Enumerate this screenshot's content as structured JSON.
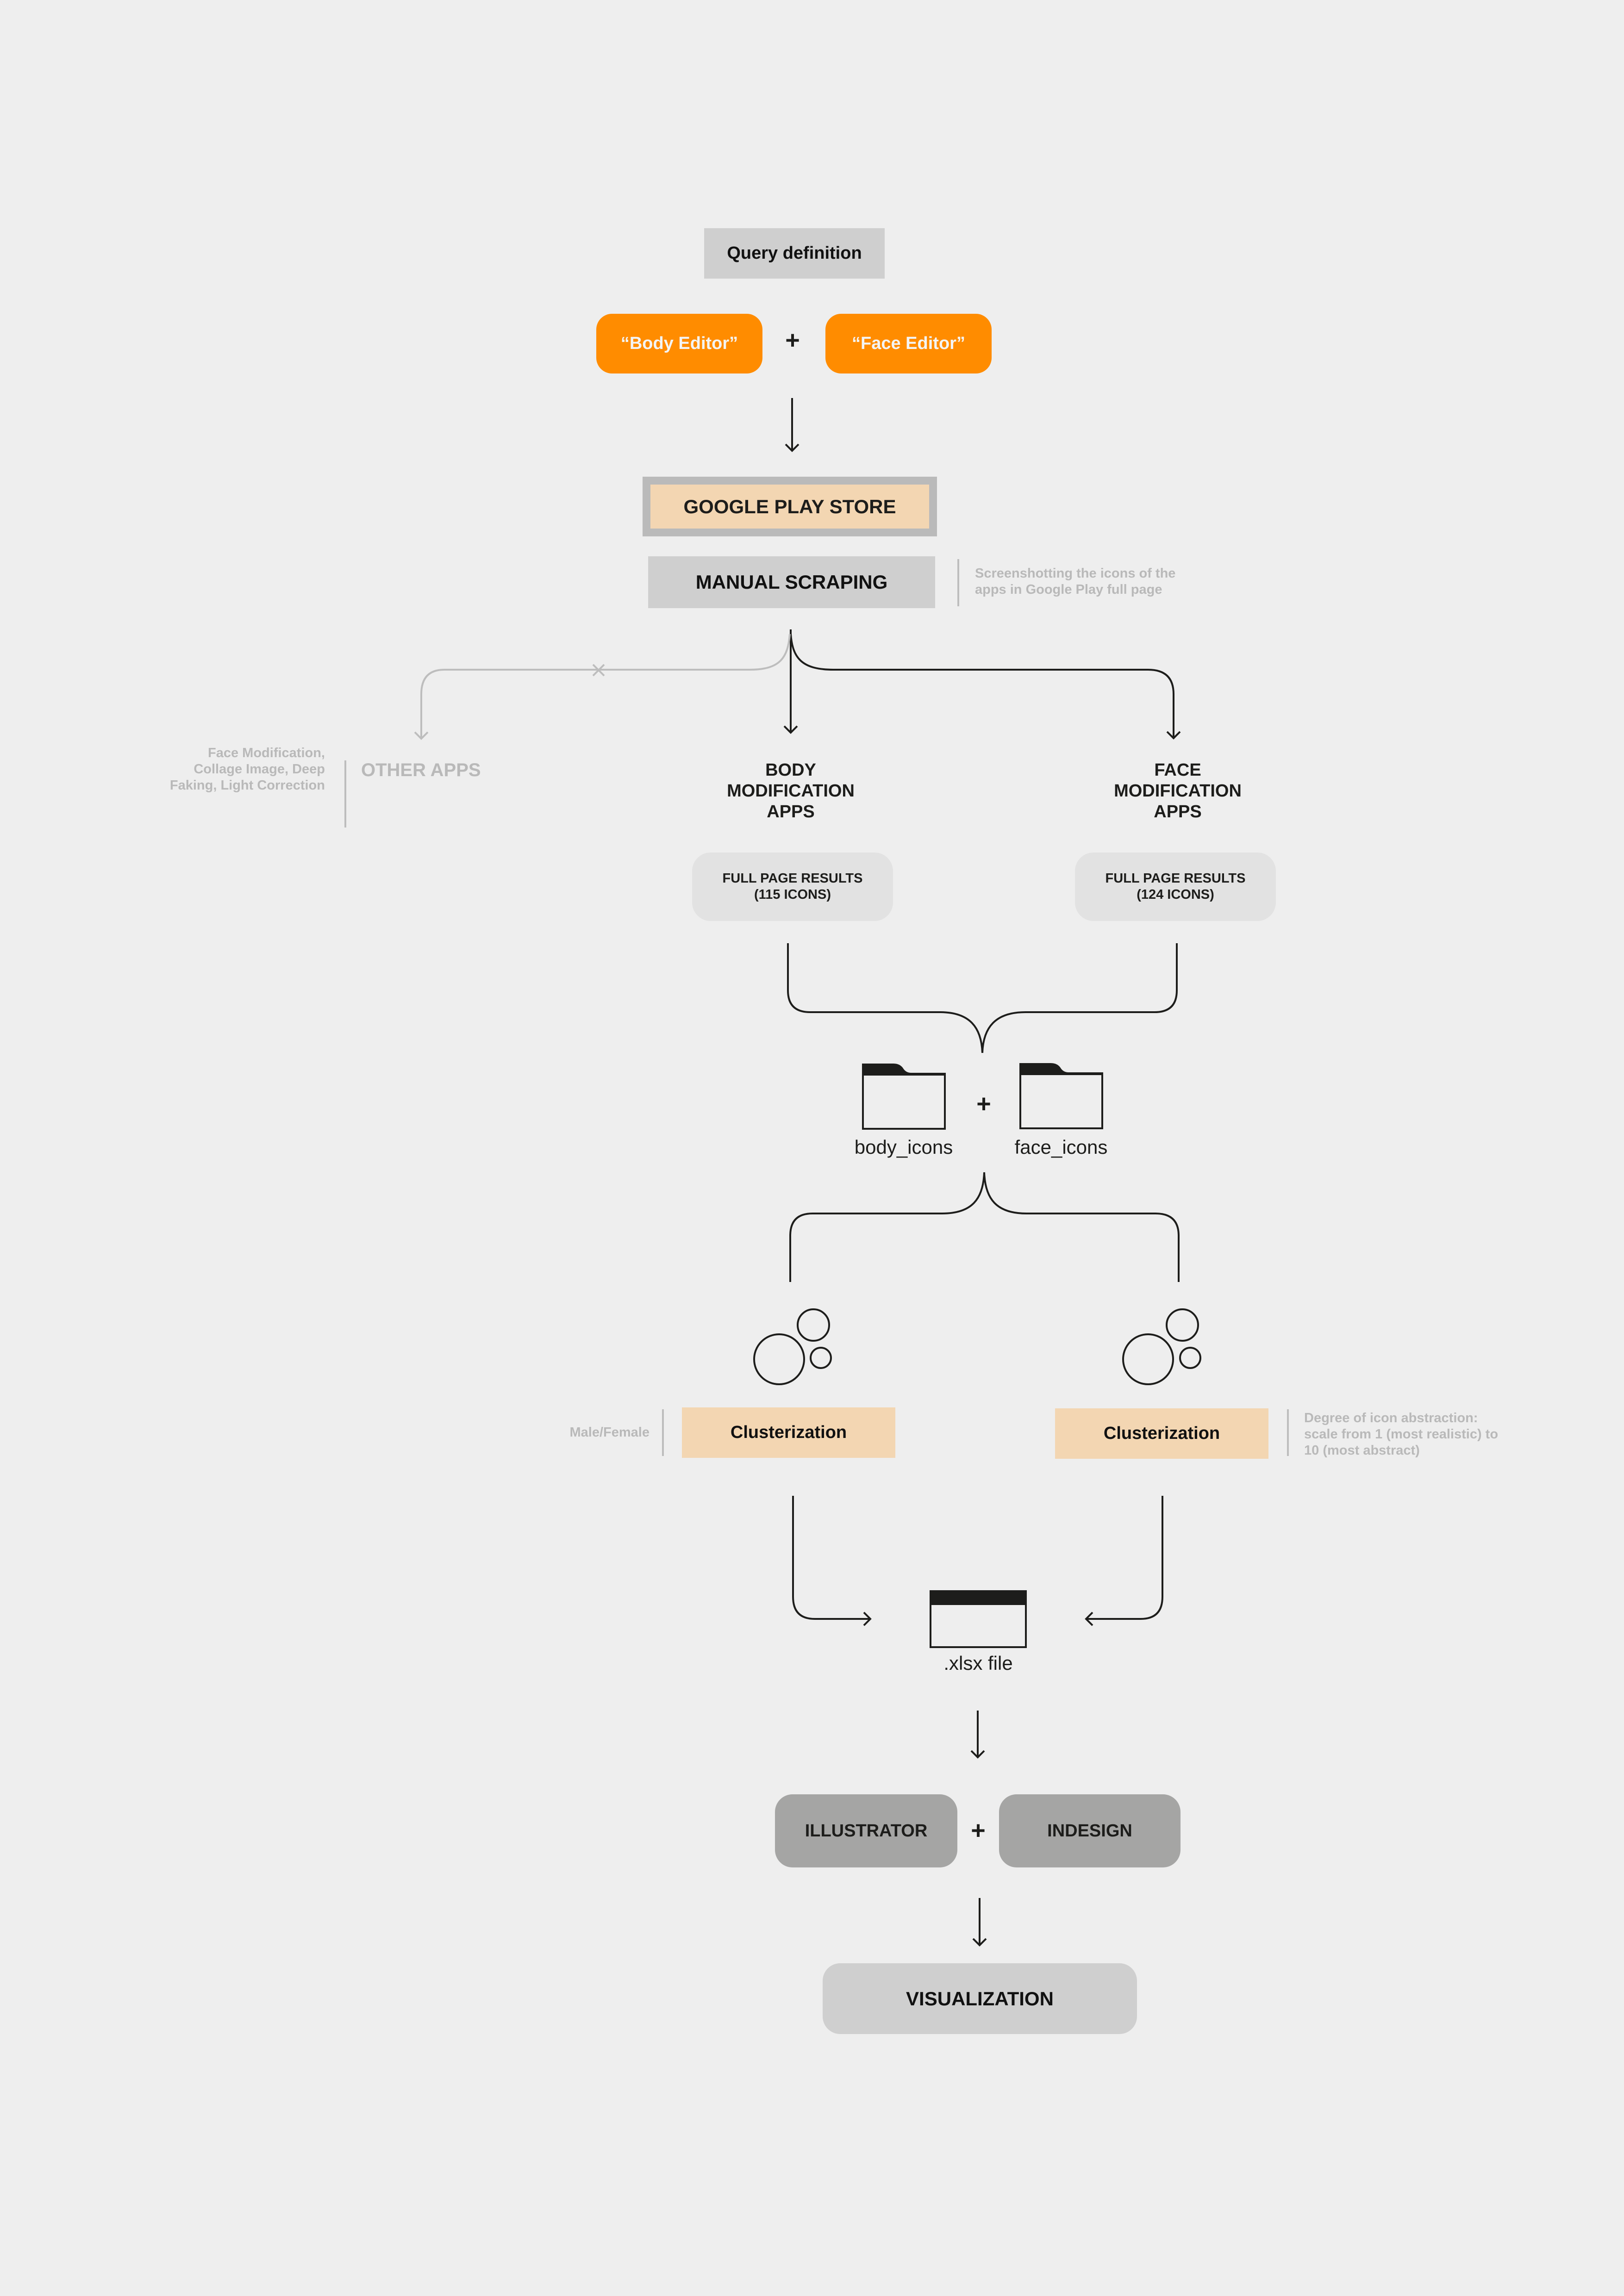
{
  "colors": {
    "background": "#eeeeee",
    "orange": "#ff8c00",
    "peach": "#f3d6b2",
    "light_gray": "#cfcfcf",
    "pill_gray": "#e2e2e2",
    "dark_pill": "#a5a5a4",
    "frame_gray": "#bababa",
    "note_gray": "#b9b9b9",
    "ink": "#1d1d1b"
  },
  "query": {
    "title": "Query definition",
    "terms": [
      "“Body Editor”",
      "“Face Editor”"
    ],
    "plus": "+"
  },
  "source": {
    "label": "GOOGLE PLAY STORE"
  },
  "scraping": {
    "label": "MANUAL SCRAPING",
    "note": "Screenshotting the icons of the apps in Google Play full page"
  },
  "branches": {
    "other": {
      "label": "OTHER APPS",
      "note": "Face Modification, Collage Image, Deep Faking, Light Correction",
      "excluded_mark": "×"
    },
    "body": {
      "label_lines": [
        "BODY",
        "MODIFICATION",
        "APPS"
      ],
      "results_lines": [
        "FULL PAGE RESULTS",
        "(115 ICONS)"
      ]
    },
    "face": {
      "label_lines": [
        "FACE",
        "MODIFICATION",
        "APPS"
      ],
      "results_lines": [
        "FULL PAGE RESULTS",
        "(124 ICONS)"
      ]
    }
  },
  "folders": {
    "body": "body_icons",
    "face": "face_icons",
    "plus": "+"
  },
  "clusterization": {
    "left": {
      "label": "Clusterization",
      "note": "Male/Female"
    },
    "right": {
      "label": "Clusterization",
      "note": "Degree of icon abstraction: scale from 1 (most realistic) to 10 (most abstract)"
    }
  },
  "output_file": {
    "label": ".xlsx file"
  },
  "tools": {
    "items": [
      "ILLUSTRATOR",
      "INDESIGN"
    ],
    "plus": "+"
  },
  "result": {
    "label": "VISUALIZATION"
  }
}
